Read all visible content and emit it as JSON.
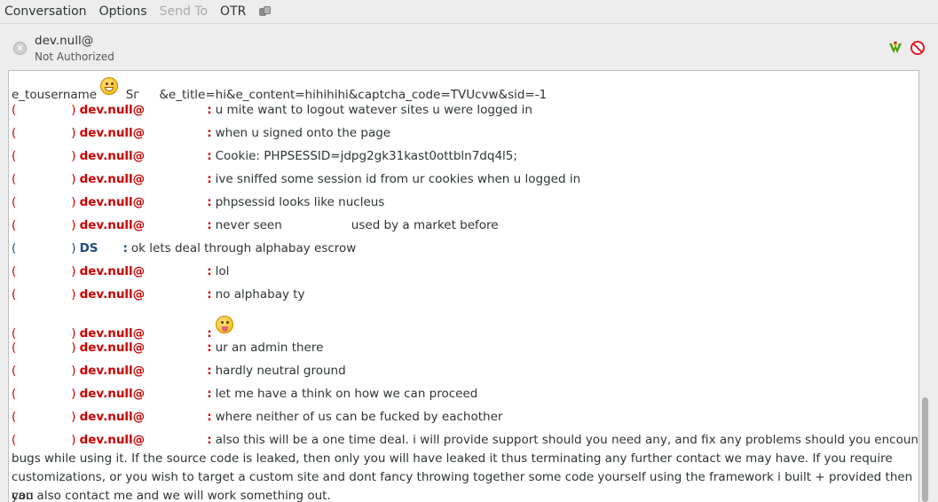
{
  "menu": {
    "conversation": "Conversation",
    "options": "Options",
    "send_to": "Send To",
    "otr": "OTR"
  },
  "buddy": {
    "name": "dev.null@",
    "status": "Not Authorized"
  },
  "colors": {
    "nick_red": "#cc0000",
    "nick_blue": "#204a87"
  },
  "first_line": {
    "part1": "e_tousername",
    "part2": "Sг",
    "part3": "&e_title=hi&e_content=hihihihi&captcha_code=TVUcvw&sid=-1"
  },
  "messages": [
    {
      "open": "(",
      "close": ")",
      "nick": "dev.null@",
      "sep": ":",
      "text": "u mite want to logout watever sites u were logged in"
    },
    {
      "open": "(",
      "close": ")",
      "nick": "dev.null@",
      "sep": ":",
      "text": "when u signed onto the page"
    },
    {
      "open": "(",
      "close": ")",
      "nick": "dev.null@",
      "sep": ":",
      "text": "Cookie: PHPSESSID=jdpg2gk31kast0ottbln7dq4l5;"
    },
    {
      "open": "(",
      "close": ")",
      "nick": "dev.null@",
      "sep": ":",
      "text": "ive sniffed some session id from ur cookies when u logged in"
    },
    {
      "open": "(",
      "close": ")",
      "nick": "dev.null@",
      "sep": ":",
      "text": "phpsessid looks like nucleus"
    },
    {
      "open": "(",
      "close": ")",
      "nick": "dev.null@",
      "sep": ":",
      "text": "never seen",
      "text2": "used by a market before"
    },
    {
      "open": "(",
      "close": ")",
      "nick": "DS",
      "sep": ":",
      "text": "ok lets deal through alphabay escrow"
    },
    {
      "open": "(",
      "close": ")",
      "nick": "dev.null@",
      "sep": ":",
      "text": "lol"
    },
    {
      "open": "(",
      "close": ")",
      "nick": "dev.null@",
      "sep": ":",
      "text": "no alphabay ty"
    },
    {
      "open": "(",
      "close": ")",
      "nick": "dev.null@",
      "sep": ":",
      "text": ""
    },
    {
      "open": "(",
      "close": ")",
      "nick": "dev.null@",
      "sep": ":",
      "text": "ur an admin there"
    },
    {
      "open": "(",
      "close": ")",
      "nick": "dev.null@",
      "sep": ":",
      "text": "hardly neutral ground"
    },
    {
      "open": "(",
      "close": ")",
      "nick": "dev.null@",
      "sep": ":",
      "text": "let me have a think on how we can proceed"
    },
    {
      "open": "(",
      "close": ")",
      "nick": "dev.null@",
      "sep": ":",
      "text": "where neither of us can be fucked by eachother"
    },
    {
      "open": "(",
      "close": ")",
      "nick": "dev.null@",
      "sep": ":",
      "text": "also this will be a one time deal. i will provide support should you need any, and fix any problems should you encounter any"
    }
  ],
  "wrapped_lines": [
    "bugs while using it. If the source code is leaked, then only you will have leaked it thus terminating any further contact we may have. If you require",
    "customizations, or you wish to target a custom site and dont fancy throwing together some code yourself using the framework i built + provided then you",
    "can also contact me and we will work something out."
  ]
}
